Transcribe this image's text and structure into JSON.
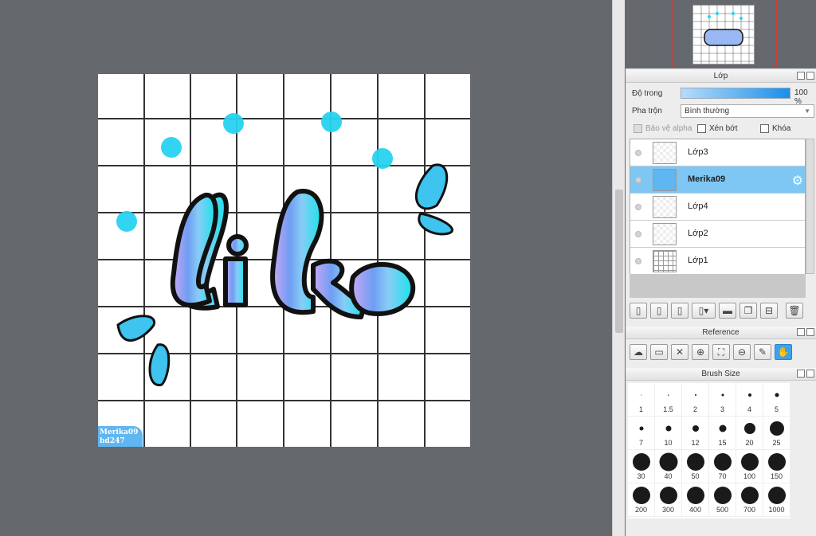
{
  "canvas": {
    "signature_line1": "Merika09",
    "signature_line2": "hd247"
  },
  "layer_panel": {
    "title": "Lớp",
    "opacity_label": "Độ trong",
    "opacity_value": "100 %",
    "blend_label": "Pha trộn",
    "blend_value": "Bình thường",
    "protect_alpha": "Bảo vệ alpha",
    "clipping": "Xén bớt",
    "lock": "Khóa",
    "layers": [
      {
        "name": "Lớp3",
        "selected": false
      },
      {
        "name": "Merika09",
        "selected": true
      },
      {
        "name": "Lớp4",
        "selected": false
      },
      {
        "name": "Lớp2",
        "selected": false
      },
      {
        "name": "Lớp1",
        "selected": false
      }
    ]
  },
  "reference_panel": {
    "title": "Reference"
  },
  "brush_panel": {
    "title": "Brush Size",
    "sizes": [
      "1",
      "1.5",
      "2",
      "3",
      "4",
      "5",
      "7",
      "10",
      "12",
      "15",
      "20",
      "25",
      "30",
      "40",
      "50",
      "70",
      "100",
      "150",
      "200",
      "300",
      "400",
      "500",
      "700",
      "1000"
    ]
  },
  "colors": {
    "accent": "#3aa4ea",
    "selected_layer": "#7ec7f4",
    "workspace": "#65686c",
    "dots": "#27d3f0"
  }
}
